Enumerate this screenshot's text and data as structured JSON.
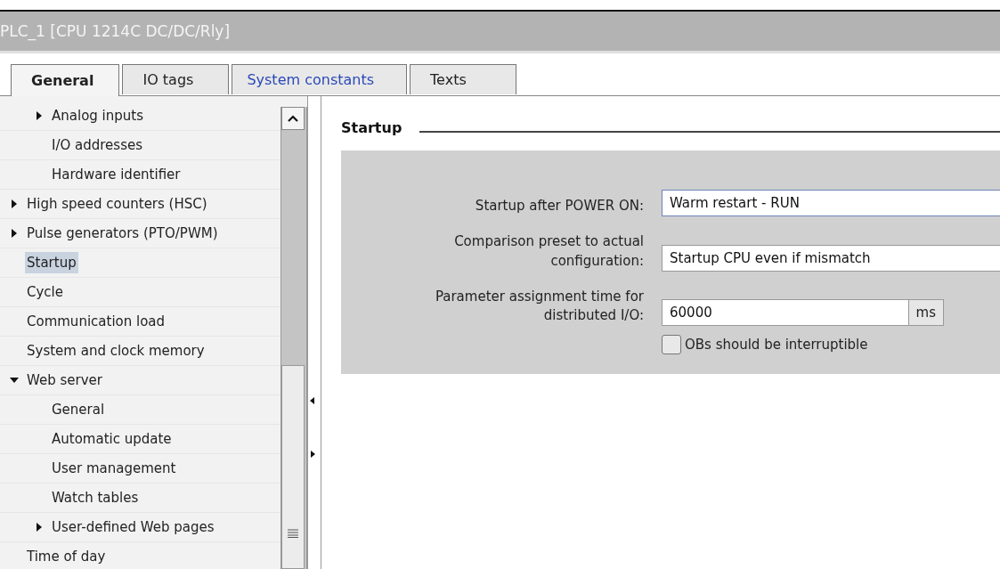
{
  "window": {
    "title": "PLC_1 [CPU 1214C DC/DC/Rly]"
  },
  "tabs": [
    {
      "label": "General",
      "selected": true,
      "hover": false
    },
    {
      "label": "IO tags",
      "selected": false,
      "hover": false
    },
    {
      "label": "System constants",
      "selected": false,
      "hover": true
    },
    {
      "label": "Texts",
      "selected": false,
      "hover": false
    }
  ],
  "tree": [
    {
      "children": [
        {
          "label": "Analog inputs",
          "expanded": false
        },
        {
          "label": "I/O addresses",
          "selected": false
        },
        {
          "label": "Hardware identifier",
          "selected": false
        }
      ]
    },
    {
      "label": "High speed counters (HSC)",
      "expanded": false
    },
    {
      "label": "Pulse generators (PTO/PWM)",
      "expanded": false
    },
    {
      "label": "Startup",
      "selected": true
    },
    {
      "label": "Cycle",
      "selected": false
    },
    {
      "label": "Communication load",
      "selected": false
    },
    {
      "label": "System and clock memory",
      "selected": false
    },
    {
      "label": "Web server",
      "expanded": true,
      "children": [
        {
          "label": "General",
          "selected": false
        },
        {
          "label": "Automatic update",
          "selected": false
        },
        {
          "label": "User management",
          "selected": false
        },
        {
          "label": "Watch tables",
          "selected": false
        },
        {
          "label": "User-defined Web pages",
          "expanded": false
        }
      ]
    },
    {
      "label": "Time of day",
      "selected": false
    }
  ],
  "section": {
    "title": "Startup",
    "params": [
      {
        "kind": "dropdown",
        "label": "Startup after POWER ON:",
        "value": "Warm restart - RUN",
        "focused": true
      },
      {
        "kind": "dropdown",
        "label": "Comparison preset to actual configuration:",
        "value": "Startup CPU even if mismatch",
        "focused": false
      },
      {
        "kind": "number",
        "label": "Parameter assignment time for distributed I/O:",
        "value": "60000",
        "unit": "ms"
      },
      {
        "kind": "checkbox",
        "label": "OBs should be interruptible",
        "checked": false
      }
    ]
  }
}
